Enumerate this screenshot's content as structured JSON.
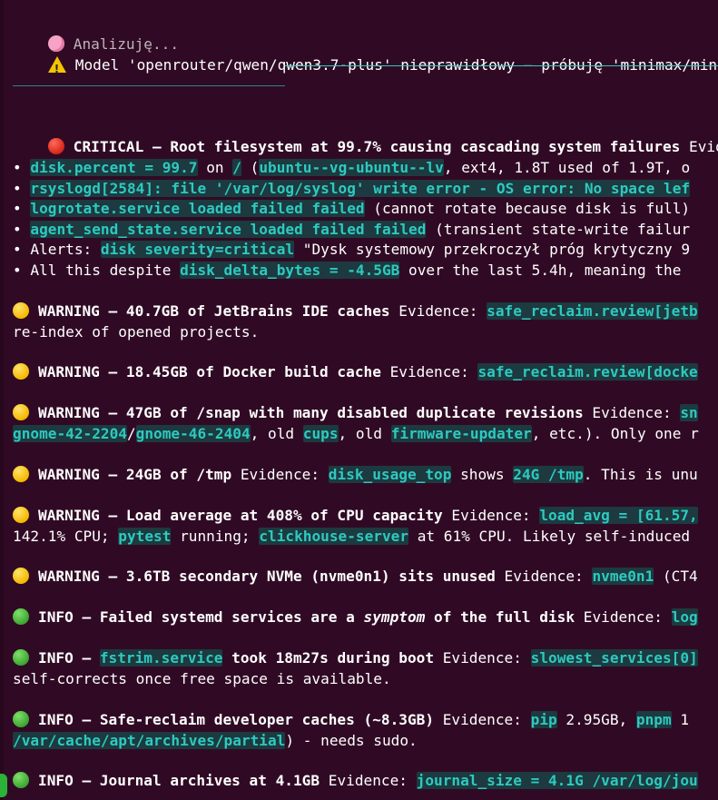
{
  "status": {
    "analyzing": "Analizuję...",
    "model_warning": "Model 'openrouter/qwen/qwen3.7-plus' nieprawidłowy — próbuję 'minimax/mini"
  },
  "critical": {
    "title": "CRITICAL — Root filesystem at 99.7% causing cascading system failures",
    "evidence_label": " Evide",
    "bullets": [
      {
        "parts": [
          {
            "t": "• ",
            "s": "n"
          },
          {
            "t": "disk.percent = 99.7",
            "s": "c"
          },
          {
            "t": " on ",
            "s": "n"
          },
          {
            "t": "/",
            "s": "c"
          },
          {
            "t": " (",
            "s": "n"
          },
          {
            "t": "ubuntu--vg-ubuntu--lv",
            "s": "c"
          },
          {
            "t": ", ext4, 1.8T used of 1.9T, o",
            "s": "n"
          }
        ]
      },
      {
        "parts": [
          {
            "t": "• ",
            "s": "n"
          },
          {
            "t": "rsyslogd[2584]: file '/var/log/syslog' write error - OS error: No space lef",
            "s": "c"
          }
        ]
      },
      {
        "parts": [
          {
            "t": "• ",
            "s": "n"
          },
          {
            "t": "logrotate.service loaded failed failed",
            "s": "c"
          },
          {
            "t": " (cannot rotate because disk is full)",
            "s": "n"
          }
        ]
      },
      {
        "parts": [
          {
            "t": "• ",
            "s": "n"
          },
          {
            "t": "agent_send_state.service loaded failed failed",
            "s": "c"
          },
          {
            "t": " (transient state-write failur",
            "s": "n"
          }
        ]
      },
      {
        "parts": [
          {
            "t": "• Alerts: ",
            "s": "n"
          },
          {
            "t": "disk severity=critical",
            "s": "c"
          },
          {
            "t": " \"Dysk systemowy przekroczył próg krytyczny 9",
            "s": "n"
          }
        ]
      },
      {
        "parts": [
          {
            "t": "• All this despite ",
            "s": "n"
          },
          {
            "t": "disk_delta_bytes = -4.5GB",
            "s": "c"
          },
          {
            "t": " over the last 5.4h, meaning the",
            "s": "n"
          }
        ]
      }
    ]
  },
  "findings": [
    {
      "level": "yellow",
      "title": "WARNING — 40.7GB of JetBrains IDE caches",
      "tail": [
        {
          "t": " Evidence: ",
          "s": "n"
        },
        {
          "t": "safe_reclaim.review[jetb",
          "s": "c"
        }
      ],
      "cont": [
        {
          "t": "re-index of opened projects.",
          "s": "n"
        }
      ]
    },
    {
      "level": "yellow",
      "title": "WARNING — 18.45GB of Docker build cache",
      "tail": [
        {
          "t": " Evidence: ",
          "s": "n"
        },
        {
          "t": "safe_reclaim.review[docke",
          "s": "c"
        }
      ],
      "cont": null
    },
    {
      "level": "yellow",
      "title": "WARNING — 47GB of /snap with many disabled duplicate revisions",
      "tail": [
        {
          "t": " Evidence: ",
          "s": "n"
        },
        {
          "t": "sn",
          "s": "c"
        }
      ],
      "cont": [
        {
          "t": "gnome-42-2204",
          "s": "c"
        },
        {
          "t": "/",
          "s": "n"
        },
        {
          "t": "gnome-46-2404",
          "s": "c"
        },
        {
          "t": ", old ",
          "s": "n"
        },
        {
          "t": "cups",
          "s": "c"
        },
        {
          "t": ", old ",
          "s": "n"
        },
        {
          "t": "firmware-updater",
          "s": "c"
        },
        {
          "t": ", etc.). Only one r",
          "s": "n"
        }
      ]
    },
    {
      "level": "yellow",
      "title": "WARNING — 24GB of /tmp",
      "tail": [
        {
          "t": " Evidence: ",
          "s": "n"
        },
        {
          "t": "disk_usage_top",
          "s": "c"
        },
        {
          "t": " shows ",
          "s": "n"
        },
        {
          "t": "24G /tmp",
          "s": "c"
        },
        {
          "t": ". This is unu",
          "s": "n"
        }
      ],
      "cont": null
    },
    {
      "level": "yellow",
      "title": "WARNING — Load average at 408% of CPU capacity",
      "tail": [
        {
          "t": " Evidence: ",
          "s": "n"
        },
        {
          "t": "load_avg = [61.57,",
          "s": "c"
        }
      ],
      "cont": [
        {
          "t": "142.1% CPU; ",
          "s": "n"
        },
        {
          "t": "pytest",
          "s": "c"
        },
        {
          "t": " running; ",
          "s": "n"
        },
        {
          "t": "clickhouse-server",
          "s": "c"
        },
        {
          "t": " at 61% CPU. Likely self-induced",
          "s": "n"
        }
      ]
    },
    {
      "level": "yellow",
      "title": "WARNING — 3.6TB secondary NVMe (nvme0n1) sits unused",
      "tail": [
        {
          "t": " Evidence: ",
          "s": "n"
        },
        {
          "t": "nvme0n1",
          "s": "c"
        },
        {
          "t": " (CT4",
          "s": "n"
        }
      ],
      "cont": null
    },
    {
      "level": "green",
      "title": "INFO — Failed systemd services are a |symptom| of the full disk",
      "tail": [
        {
          "t": " Evidence: ",
          "s": "n"
        },
        {
          "t": "log",
          "s": "c"
        }
      ],
      "cont": null
    },
    {
      "level": "green",
      "title": "INFO — |fstrim.service| took 18m27s during boot",
      "tail": [
        {
          "t": " Evidence: ",
          "s": "n"
        },
        {
          "t": "slowest_services[0]",
          "s": "c"
        }
      ],
      "cont": [
        {
          "t": "self-corrects once free space is available.",
          "s": "n"
        }
      ]
    },
    {
      "level": "green",
      "title": "INFO — Safe-reclaim developer caches (~8.3GB)",
      "tail": [
        {
          "t": " Evidence: ",
          "s": "n"
        },
        {
          "t": "pip",
          "s": "c"
        },
        {
          "t": " 2.95GB, ",
          "s": "n"
        },
        {
          "t": "pnpm",
          "s": "c"
        },
        {
          "t": " 1",
          "s": "n"
        }
      ],
      "cont": [
        {
          "t": "/var/cache/apt/archives/partial",
          "s": "c"
        },
        {
          "t": ") - needs sudo.",
          "s": "n"
        }
      ]
    },
    {
      "level": "green",
      "title": "INFO — Journal archives at 4.1GB",
      "tail": [
        {
          "t": " Evidence: ",
          "s": "n"
        },
        {
          "t": "journal_size = 4.1G /var/log/jou",
          "s": "c"
        }
      ],
      "cont": null
    }
  ],
  "colors": {
    "background": "#300a24",
    "code": "#2ec9c0",
    "critical": "#e0301e",
    "warning": "#f5b800",
    "info": "#3ca632"
  },
  "icons": {
    "analyzing": "brain-icon",
    "warning": "warning-icon",
    "critical": "red-circle-icon",
    "warning_level": "yellow-circle-icon",
    "info_level": "green-circle-icon"
  }
}
